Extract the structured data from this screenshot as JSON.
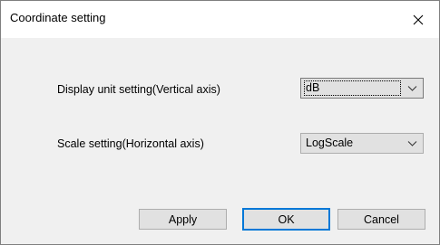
{
  "window": {
    "title": "Coordinate setting"
  },
  "form": {
    "vertical_label": "Display unit setting(Vertical axis)",
    "vertical_value": "dB",
    "horizontal_label": "Scale setting(Horizontal axis)",
    "horizontal_value": "LogScale"
  },
  "buttons": {
    "apply": "Apply",
    "ok": "OK",
    "cancel": "Cancel"
  },
  "icons": {
    "close": "close-icon",
    "dropdown": "chevron-down-icon"
  },
  "colors": {
    "default_button_border": "#0078d7",
    "dialog_background": "#f0f0f0",
    "titlebar_background": "#ffffff"
  }
}
